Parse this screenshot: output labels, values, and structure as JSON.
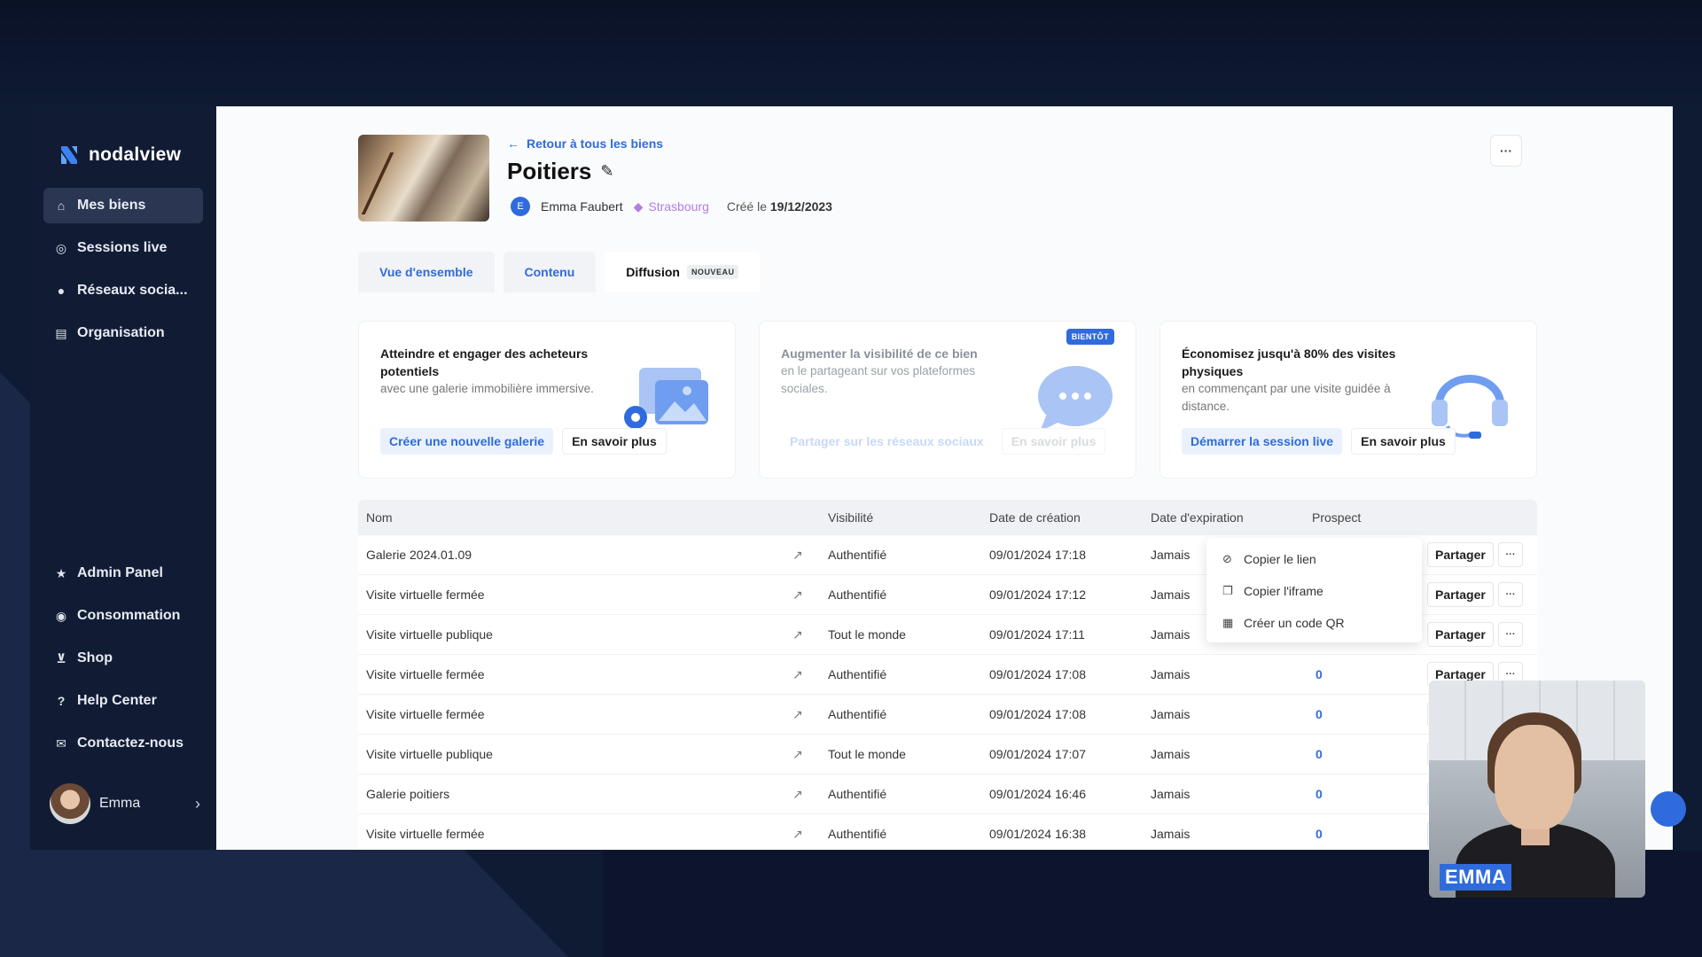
{
  "app": {
    "brand": "nodalview"
  },
  "sidebar": {
    "items": [
      {
        "label": "Mes biens",
        "icon": "home-icon"
      },
      {
        "label": "Sessions live",
        "icon": "headset-icon"
      },
      {
        "label": "Réseaux socia...",
        "icon": "chat-icon"
      },
      {
        "label": "Organisation",
        "icon": "briefcase-icon"
      }
    ],
    "bottom_items": [
      {
        "label": "Admin Panel",
        "icon": "star-icon"
      },
      {
        "label": "Consommation",
        "icon": "coin-icon"
      },
      {
        "label": "Shop",
        "icon": "cart-icon"
      },
      {
        "label": "Help Center",
        "icon": "question-icon"
      },
      {
        "label": "Contactez-nous",
        "icon": "mail-icon"
      }
    ],
    "user": {
      "name": "Emma"
    }
  },
  "property": {
    "back_label": "Retour à tous les biens",
    "title": "Poitiers",
    "owner_initial": "E",
    "owner": "Emma Faubert",
    "tag": "Strasbourg",
    "created_label": "Créé le",
    "created_date": "19/12/2023",
    "more": "···"
  },
  "tabs": [
    {
      "label": "Vue d'ensemble"
    },
    {
      "label": "Contenu"
    },
    {
      "label": "Diffusion",
      "badge": "NOUVEAU"
    }
  ],
  "cards": [
    {
      "title": "Atteindre et engager des acheteurs potentiels",
      "desc": "avec une galerie immobilière immersive.",
      "primary": "Créer une nouvelle galerie",
      "secondary": "En savoir plus"
    },
    {
      "title": "Augmenter la visibilité de ce bien",
      "desc": "en le partageant sur vos plateformes sociales.",
      "primary": "Partager sur les réseaux sociaux",
      "secondary": "En savoir plus",
      "badge": "BIENTÔT"
    },
    {
      "title": "Économisez jusqu'à 80% des visites physiques",
      "desc": "en commençant par une visite guidée à distance.",
      "primary": "Démarrer la session live",
      "secondary": "En savoir plus"
    }
  ],
  "table": {
    "headers": {
      "name": "Nom",
      "visibility": "Visibilité",
      "created": "Date de création",
      "expiration": "Date d'expiration",
      "prospect": "Prospect"
    },
    "share_label": "Partager",
    "more_label": "···",
    "rows": [
      {
        "name": "Galerie 2024.01.09",
        "visibility": "Authentifié",
        "created": "09/01/2024 17:18",
        "expiration": "Jamais",
        "prospect": ""
      },
      {
        "name": "Visite virtuelle fermée",
        "visibility": "Authentifié",
        "created": "09/01/2024 17:12",
        "expiration": "Jamais",
        "prospect": ""
      },
      {
        "name": "Visite virtuelle publique",
        "visibility": "Tout le monde",
        "created": "09/01/2024 17:11",
        "expiration": "Jamais",
        "prospect": ""
      },
      {
        "name": "Visite virtuelle fermée",
        "visibility": "Authentifié",
        "created": "09/01/2024 17:08",
        "expiration": "Jamais",
        "prospect": "0"
      },
      {
        "name": "Visite virtuelle fermée",
        "visibility": "Authentifié",
        "created": "09/01/2024 17:08",
        "expiration": "Jamais",
        "prospect": "0"
      },
      {
        "name": "Visite virtuelle publique",
        "visibility": "Tout le monde",
        "created": "09/01/2024 17:07",
        "expiration": "Jamais",
        "prospect": "0"
      },
      {
        "name": "Galerie poitiers",
        "visibility": "Authentifié",
        "created": "09/01/2024 16:46",
        "expiration": "Jamais",
        "prospect": "0"
      },
      {
        "name": "Visite virtuelle fermée",
        "visibility": "Authentifié",
        "created": "09/01/2024 16:38",
        "expiration": "Jamais",
        "prospect": "0"
      }
    ]
  },
  "dropdown": {
    "items": [
      {
        "label": "Copier le lien",
        "icon": "link-icon"
      },
      {
        "label": "Copier l'iframe",
        "icon": "copy-icon"
      },
      {
        "label": "Créer un code QR",
        "icon": "qr-icon"
      }
    ]
  },
  "webcam": {
    "name": "EMMA"
  },
  "colors": {
    "accent": "#2f6bdc",
    "sidebar": "#111c34",
    "tag": "#b07fe0"
  }
}
